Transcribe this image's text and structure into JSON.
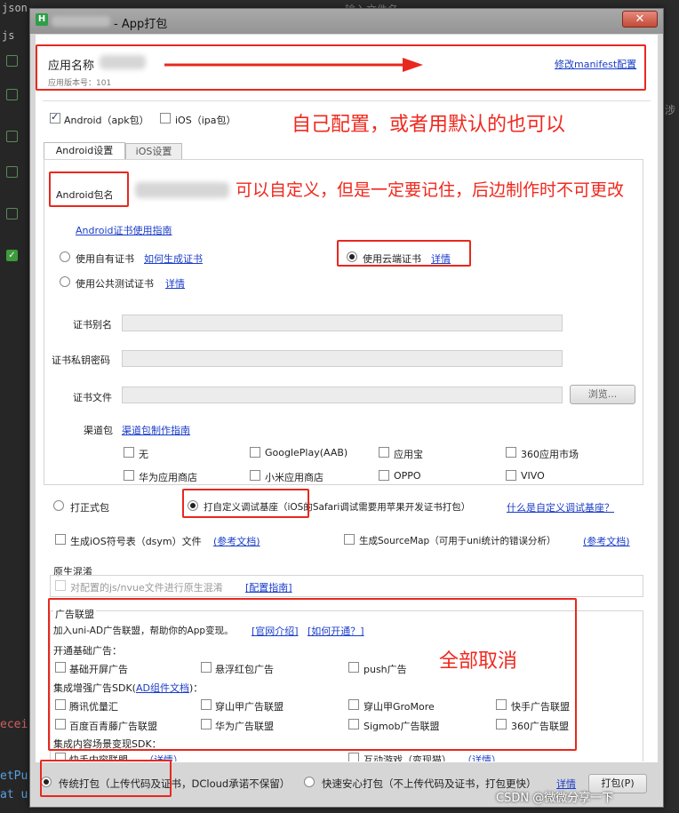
{
  "background": {
    "top_text": "json",
    "js_text": "js",
    "input_hint": "输入文件名",
    "side_text": "涉",
    "red_text": "ecei",
    "blue_text_1": "etPu",
    "blue_text_2": "at u",
    "check_mark": "✓"
  },
  "window": {
    "logo": "H",
    "title": "- App打包",
    "close": "✕"
  },
  "app_info": {
    "name_label": "应用名称",
    "version": "应用版本号：101",
    "manifest_link": "修改manifest配置"
  },
  "platforms": {
    "android": "Android（apk包）",
    "ios": "iOS（ipa包）"
  },
  "tabs": [
    "Android设置",
    "iOS设置"
  ],
  "android": {
    "package_label": "Android包名",
    "cert_guide": "Android证书使用指南",
    "own_cert": "使用自有证书",
    "how_to_gen": "如何生成证书",
    "public_cert": "使用公共测试证书",
    "detail": "详情",
    "cloud_cert": "使用云端证书",
    "alias_label": "证书别名",
    "pwd_label": "证书私钥密码",
    "file_label": "证书文件",
    "browse": "浏览...",
    "channel_label": "渠道包",
    "channel_guide": "渠道包制作指南",
    "channels": [
      "无",
      "GooglePlay(AAB)",
      "应用宝",
      "360应用市场",
      "华为应用商店",
      "小米应用商店",
      "OPPO",
      "VIVO"
    ]
  },
  "build": {
    "release": "打正式包",
    "custom_base": "打自定义调试基座（iOS的Safari调试需要用苹果开发证书打包）",
    "what_is_base": "什么是自定义调试基座？",
    "dsym": "生成iOS符号表（dsym）文件",
    "ref_doc": "(参考文档)",
    "sourcemap": "生成SourceMap（可用于uni统计的错误分析）"
  },
  "native_obf": {
    "header": "原生混淆",
    "label": "对配置的js/nvue文件进行原生混淆",
    "guide": "[配置指南]"
  },
  "ads": {
    "header": "广告联盟",
    "intro": "加入uni-AD广告联盟，帮助你的App变现。",
    "official": "[官网介绍]",
    "how_open": "[如何开通？]",
    "basic_header": "开通基础广告：",
    "basic": [
      "基础开屏广告",
      "悬浮红包广告",
      "push广告"
    ],
    "enhanced_header_1": "集成增强广告SDK(",
    "enhanced_link": "AD组件文档",
    "enhanced_header_2": ")：",
    "enhanced": [
      "腾讯优量汇",
      "穿山甲广告联盟",
      "穿山甲GroMore",
      "快手广告联盟",
      "百度百青藤广告联盟",
      "华为广告联盟",
      "Sigmob广告联盟",
      "360广告联盟"
    ],
    "content_header": "集成内容场景变现SDK：",
    "content": [
      "快手内容联盟",
      "（详情）",
      "互动游戏（变现猫）",
      "（详情）"
    ]
  },
  "footer": {
    "traditional": "传统打包（上传代码及证书，DCloud承诺不保留）",
    "fast": "快速安心打包（不上传代码及证书，打包更快）",
    "detail": "详情",
    "pack_button": "打包(P)"
  },
  "annotations": {
    "config": "自己配置，或者用默认的也可以",
    "custom": "可以自定义，但是一定要记住，后边制作时不可更改",
    "cancel_all": "全部取消"
  },
  "watermark": "CSDN @微微分享一下",
  "colors": {
    "annotation_red": "#e8281e",
    "link_blue": "#1a3cc8",
    "logo_green": "#2e9e48"
  }
}
